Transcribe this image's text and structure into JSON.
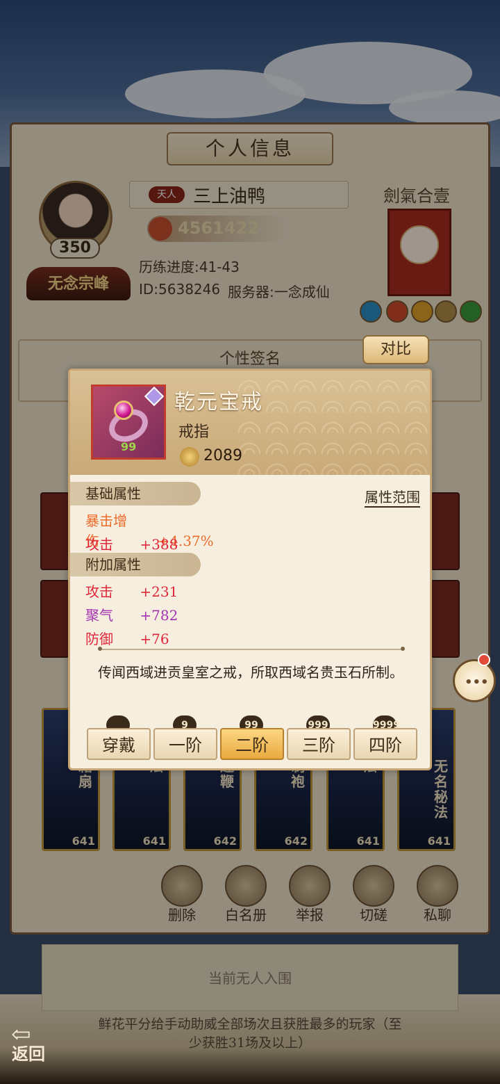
{
  "panel": {
    "title": "个人信息"
  },
  "player": {
    "level": "350",
    "sect": "无念宗峰",
    "title_tag": "天人",
    "name": "三上油鸭",
    "power": "4561422",
    "progress": "历练进度:41-43",
    "id": "ID:5638246",
    "server": "服务器:一念成仙",
    "emblem_title": "劍氣合壹"
  },
  "signature": {
    "title": "个性签名",
    "compare": "对比"
  },
  "skills": [
    {
      "name": "霜扇",
      "level": "641"
    },
    {
      "name": "法",
      "level": "641"
    },
    {
      "name": "连鞭",
      "level": "642"
    },
    {
      "name": "制袍",
      "level": "642"
    },
    {
      "name": "法",
      "level": "641"
    },
    {
      "name": "无名秘法",
      "level": "641"
    }
  ],
  "actions": [
    {
      "label": "删除",
      "icon": "delete-user-icon"
    },
    {
      "label": "白名册",
      "icon": "whitelist-book-icon"
    },
    {
      "label": "举报",
      "icon": "report-icon"
    },
    {
      "label": "切磋",
      "icon": "duel-icon"
    },
    {
      "label": "私聊",
      "icon": "private-chat-icon"
    }
  ],
  "ranking": {
    "empty": "当前无人入围",
    "note": "鲜花平分给手动助威全部场次且获胜最多的玩家（至少获胜31场及以上）"
  },
  "back_label": "返回",
  "item": {
    "name": "乾元宝戒",
    "type": "戒指",
    "score": "2089",
    "grade": "99",
    "base_title": "基础属性",
    "range_label": "属性范围",
    "base_attrs": [
      {
        "name": "暴击增伤",
        "value": "+4.37%"
      },
      {
        "name": "攻击",
        "value": "+388"
      }
    ],
    "extra_title": "附加属性",
    "extra_attrs": [
      {
        "name": "攻击",
        "value": "+231"
      },
      {
        "name": "聚气",
        "value": "+782"
      },
      {
        "name": "防御",
        "value": "+76"
      }
    ],
    "description": "传闻西域进贡皇室之戒，所取西域名贵玉石所制。",
    "tiers": [
      {
        "label": "穿戴",
        "icon": ""
      },
      {
        "label": "一阶",
        "icon": "9"
      },
      {
        "label": "二阶",
        "icon": "99"
      },
      {
        "label": "三阶",
        "icon": "999"
      },
      {
        "label": "四阶",
        "icon": "9999"
      }
    ],
    "active_tier": "二阶"
  },
  "colors": {
    "crit": "#ec6a2a",
    "attack": "#e0273a",
    "qi": "#a532b0",
    "active_tab": "#eaa940"
  }
}
